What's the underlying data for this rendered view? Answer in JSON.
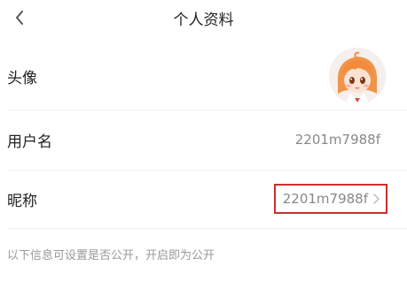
{
  "nav": {
    "title": "个人资料",
    "back_icon": "chevron-left-icon"
  },
  "profile": {
    "avatar": {
      "label": "头像",
      "icon": "avatar-anime-girl"
    },
    "username": {
      "label": "用户名",
      "value": "2201m7988f"
    },
    "nickname": {
      "label": "昵称",
      "value": "2201m7988f",
      "chevron_icon": "chevron-right-icon"
    }
  },
  "footer": {
    "note": "以下信息可设置是否公开，开启即为公开"
  },
  "colors": {
    "highlight_border": "#c9302c",
    "divider": "#eeeeee",
    "secondary_text": "#888888"
  }
}
